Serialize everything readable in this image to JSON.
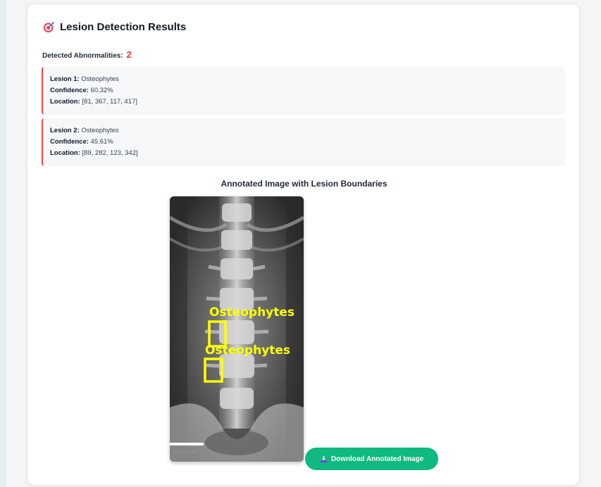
{
  "header": {
    "title": "Lesion Detection Results",
    "icon": "target-icon"
  },
  "summary": {
    "label": "Detected Abnormalities:",
    "count": "2"
  },
  "lesions": [
    {
      "name_label": "Lesion 1:",
      "name": "Osteophytes",
      "confidence_label": "Confidence:",
      "confidence": "60.32%",
      "location_label": "Location:",
      "location": "[81, 367, 117, 417]"
    },
    {
      "name_label": "Lesion 2:",
      "name": "Osteophytes",
      "confidence_label": "Confidence:",
      "confidence": "45.61%",
      "location_label": "Location:",
      "location": "[89, 282, 123, 342]"
    }
  ],
  "annotated_image": {
    "title": "Annotated Image with Lesion Boundaries",
    "box_labels": [
      "Osteophytes",
      "Osteophytes"
    ],
    "box_color": "#ffff00"
  },
  "download_button": {
    "label": "Download Annotated Image",
    "icon": "download-icon",
    "color": "#10b981"
  },
  "colors": {
    "accent_red": "#ef4444",
    "count_red": "#e53935"
  }
}
